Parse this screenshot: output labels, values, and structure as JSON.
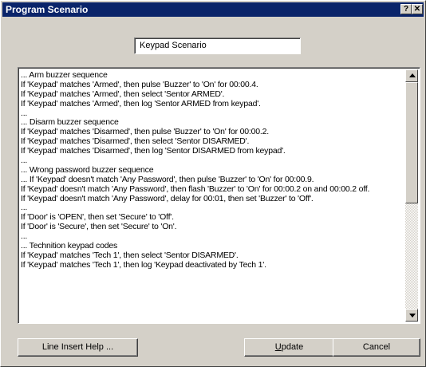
{
  "window": {
    "title": "Program Scenario",
    "help_glyph": "?",
    "close_glyph": "✕"
  },
  "scenario_name": {
    "value": "Keypad Scenario"
  },
  "script": {
    "lines": [
      "... Arm buzzer sequence",
      "If 'Keypad' matches 'Armed', then pulse 'Buzzer' to 'On' for 00:00.4.",
      "If 'Keypad' matches 'Armed', then select 'Sentor ARMED'.",
      "If 'Keypad' matches 'Armed', then log 'Sentor ARMED from keypad'.",
      "...",
      "... Disarm buzzer sequence",
      "If 'Keypad' matches 'Disarmed', then pulse 'Buzzer' to 'On' for 00:00.2.",
      "If 'Keypad' matches 'Disarmed', then select 'Sentor DISARMED'.",
      "If 'Keypad' matches 'Disarmed', then log 'Sentor DISARMED from keypad'.",
      "...",
      "... Wrong password buzzer sequence",
      "... If 'Keypad' doesn't match 'Any Password', then pulse 'Buzzer' to 'On' for 00:00.9.",
      "If 'Keypad' doesn't match 'Any Password', then flash 'Buzzer' to 'On' for 00:00.2 on and 00:00.2 off.",
      "If 'Keypad' doesn't match 'Any Password', delay for 00:01, then set 'Buzzer' to 'Off'.",
      "...",
      "If 'Door' is 'OPEN', then set 'Secure' to 'Off'.",
      "If 'Door' is 'Secure', then set 'Secure' to 'On'.",
      "...",
      "... Technition keypad codes",
      "If 'Keypad' matches 'Tech 1', then select 'Sentor DISARMED'.",
      "If 'Keypad' matches 'Tech 1', then log 'Keypad deactivated by Tech 1'."
    ]
  },
  "buttons": {
    "line_insert_help": "Line Insert Help ...",
    "update_prefix": "",
    "update_underlined": "U",
    "update_rest": "pdate",
    "cancel": "Cancel"
  },
  "colors": {
    "title_bar": "#0a246a",
    "face": "#d4d0c8"
  }
}
